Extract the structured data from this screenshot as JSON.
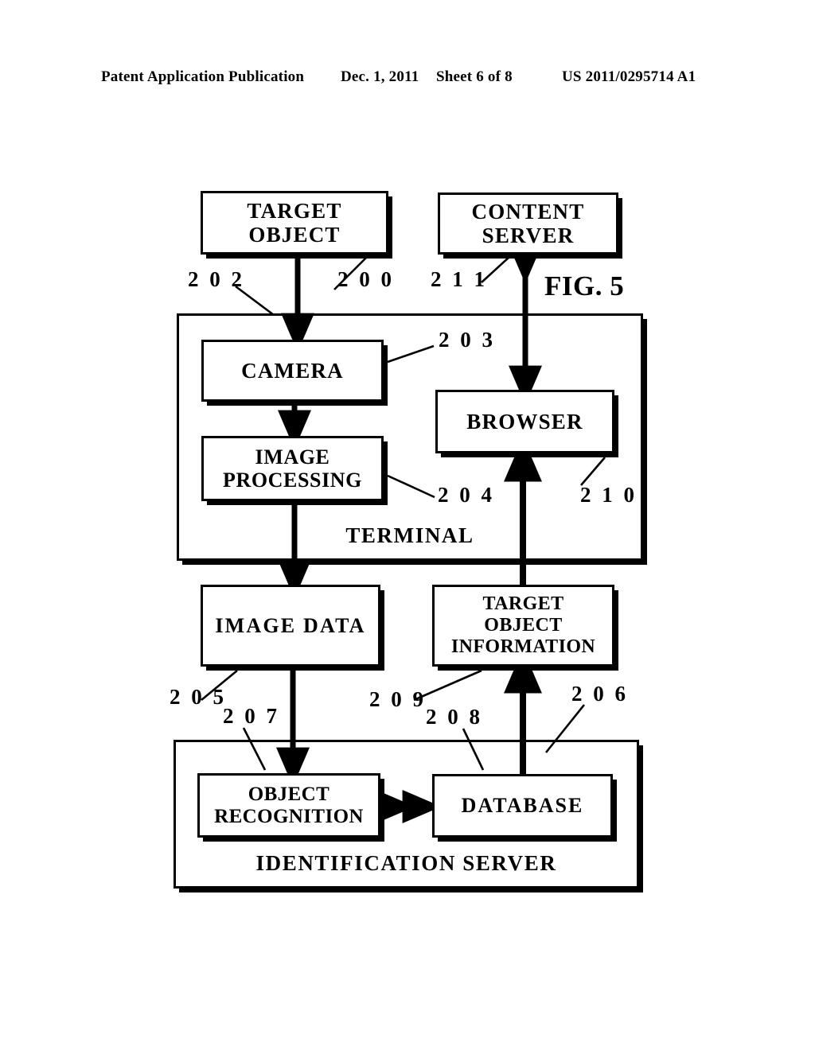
{
  "header": {
    "publication": "Patent Application Publication",
    "date": "Dec. 1, 2011",
    "sheet": "Sheet 6 of 8",
    "document_number": "US 2011/0295714 A1"
  },
  "figure": {
    "caption": "FIG. 5",
    "nodes": {
      "target_object": "TARGET\nOBJECT",
      "content_server": "CONTENT\nSERVER",
      "camera": "CAMERA",
      "image_processing": "IMAGE\nPROCESSING",
      "browser": "BROWSER",
      "image_data": "IMAGE DATA",
      "target_object_information": "TARGET\nOBJECT\nINFORMATION",
      "object_recognition": "OBJECT\nRECOGNITION",
      "database": "DATABASE"
    },
    "groups": {
      "terminal": "TERMINAL",
      "identification_server": "IDENTIFICATION SERVER"
    },
    "reference_numerals": {
      "n200": "2 0 0",
      "n202": "2 0 2",
      "n203": "2 0 3",
      "n204": "2 0 4",
      "n205": "2 0 5",
      "n206": "2 0 6",
      "n207": "2 0 7",
      "n208": "2 0 8",
      "n209": "2 0 9",
      "n210": "2 1 0",
      "n211": "2 1 1"
    }
  },
  "colors": {
    "ink": "#000000",
    "paper": "#ffffff"
  }
}
